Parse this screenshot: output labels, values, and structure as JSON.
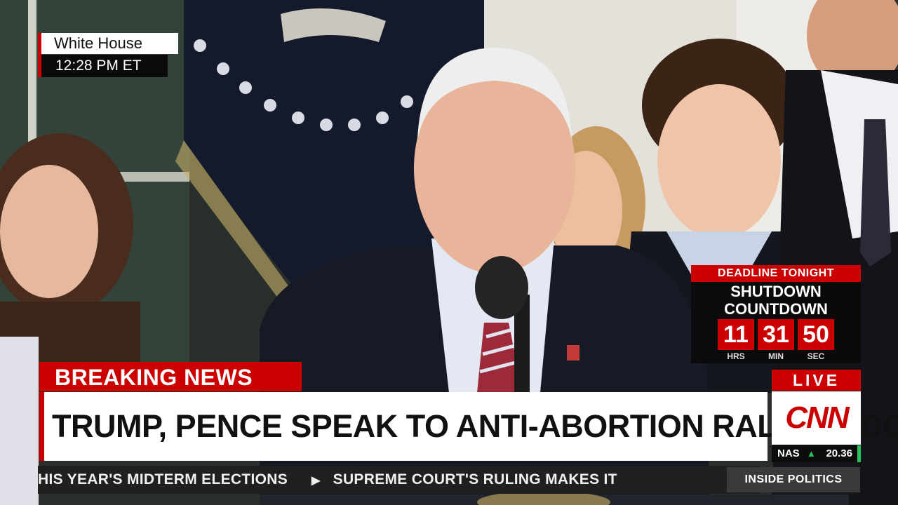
{
  "location_bug": {
    "place": "White House",
    "time": "12:28 PM ET"
  },
  "countdown": {
    "header": "DEADLINE TONIGHT",
    "title_line1": "SHUTDOWN",
    "title_line2": "COUNTDOWN",
    "hours": "11",
    "hours_label": "HRS",
    "minutes": "31",
    "minutes_label": "MIN",
    "seconds": "50",
    "seconds_label": "SEC"
  },
  "lower_third": {
    "banner": "BREAKING NEWS",
    "headline": "TRUMP, PENCE SPEAK TO ANTI-ABORTION RALLY IN DC"
  },
  "network": {
    "live_label": "LIVE",
    "logo_text": "CNN",
    "market_label": "NAS",
    "market_direction": "up",
    "market_value": "20.36"
  },
  "ticker": {
    "items": [
      "HIS YEAR'S MIDTERM ELECTIONS",
      "SUPREME COURT'S RULING MAKES IT"
    ],
    "separator_icon": "play-arrow-icon"
  },
  "show_name": "INSIDE POLITICS",
  "colors": {
    "accent_red": "#cc0000",
    "market_up_green": "#2ac45a"
  }
}
